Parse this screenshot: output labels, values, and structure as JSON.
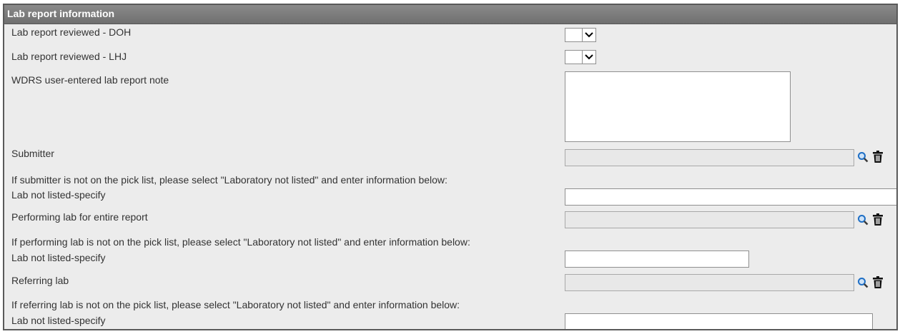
{
  "section": {
    "title": "Lab report information"
  },
  "fields": {
    "reviewed_doh": {
      "label": "Lab report reviewed - DOH",
      "value": ""
    },
    "reviewed_lhj": {
      "label": "Lab report reviewed - LHJ",
      "value": ""
    },
    "note": {
      "label": "WDRS user-entered lab report note",
      "value": ""
    },
    "submitter": {
      "label": "Submitter",
      "value": ""
    },
    "submitter_help": "If submitter is not on the pick list, please select \"Laboratory not listed\" and enter information below:",
    "submitter_not_listed": {
      "label": "Lab not listed-specify",
      "value": ""
    },
    "performing_lab": {
      "label": "Performing lab for entire report",
      "value": ""
    },
    "performing_help": "If performing lab is not on the pick list, please select \"Laboratory not listed\" and enter information below:",
    "performing_not_listed": {
      "label": "Lab not listed-specify",
      "value": ""
    },
    "referring_lab": {
      "label": "Referring lab",
      "value": ""
    },
    "referring_help": "If referring lab is not on the pick list, please select \"Laboratory not listed\" and enter information below:",
    "referring_not_listed": {
      "label": "Lab not listed-specify",
      "value": ""
    }
  },
  "icons": {
    "search": "magnifier-search-icon",
    "delete": "trash-icon",
    "dropdown": "chevron-down-icon"
  },
  "colors": {
    "header_bg": "#7a7a7a",
    "panel_bg": "#ececec",
    "icon_blue": "#1f6fc5"
  }
}
